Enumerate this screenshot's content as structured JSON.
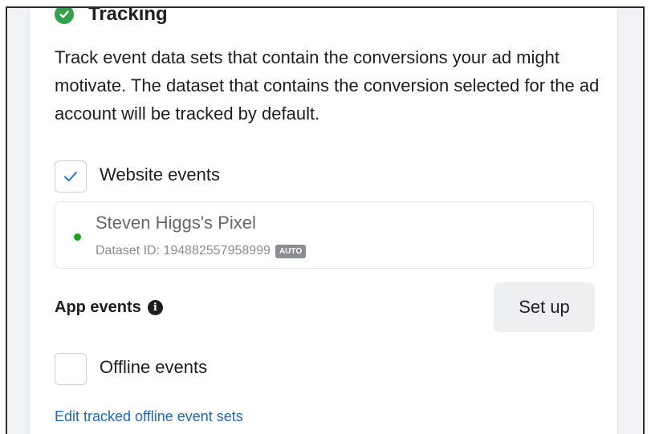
{
  "tracking": {
    "title": "Tracking",
    "description": "Track event data sets that contain the conversions your ad might motivate. The dataset that contains the conversion selected for the ad account will be tracked by default."
  },
  "website_events": {
    "label": "Website events",
    "checked": true,
    "pixel": {
      "name": "Steven Higgs's Pixel",
      "dataset_id": "Dataset ID: 194882557958999",
      "badge": "AUTO",
      "status_color": "#1aa51a"
    }
  },
  "app_events": {
    "label": "App events",
    "info_icon": "i",
    "setup_label": "Set up"
  },
  "offline_events": {
    "label": "Offline events",
    "checked": false
  },
  "edit_link": "Edit tracked offline event sets",
  "colors": {
    "success_green": "#31a24c",
    "link_blue": "#1b68c5",
    "checkmark_blue": "#1877f2"
  }
}
